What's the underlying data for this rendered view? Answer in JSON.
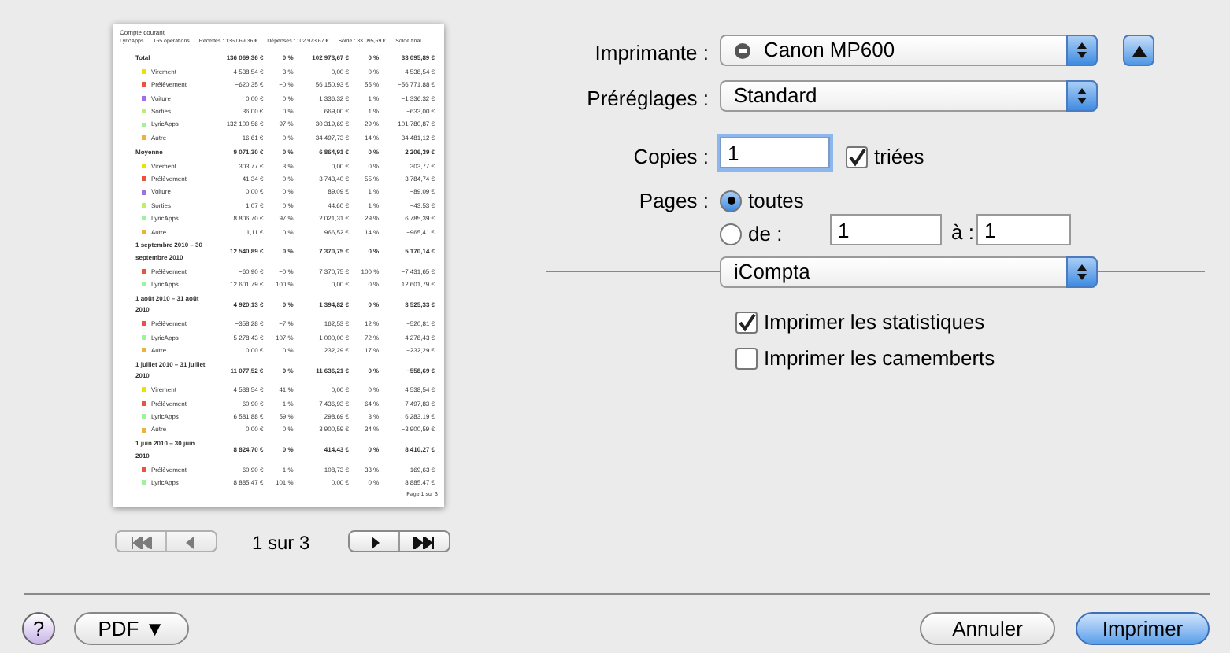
{
  "preview": {
    "document": {
      "title": "Compte courant",
      "summary": [
        "LyricApps",
        "165 opérations",
        "Recettes : 136 069,36 €",
        "Dépenses : 102 973,67 €",
        "Solde : 33 095,69 €",
        "Solde final"
      ],
      "rows": [
        {
          "kind": "group",
          "label": "Total",
          "cells": [
            "136 069,36 €",
            "0 %",
            "102 973,67 €",
            "0 %",
            "33 095,89 €"
          ]
        },
        {
          "kind": "category",
          "label": "Virement",
          "color": "#f0e000",
          "cells": [
            "4 538,54 €",
            "3 %",
            "0,00 €",
            "0 %",
            "4 538,54 €"
          ]
        },
        {
          "kind": "category",
          "label": "Prélèvement",
          "color": "#f05040",
          "cells": [
            "−620,35 €",
            "−0 %",
            "56 150,93 €",
            "55 %",
            "−56 771,88 €"
          ]
        },
        {
          "kind": "category",
          "label": "Voiture",
          "color": "#a070e0",
          "cells": [
            "0,00 €",
            "0 %",
            "1 336,32 €",
            "1 %",
            "−1 336,32 €"
          ]
        },
        {
          "kind": "category",
          "label": "Sorties",
          "color": "#c0f060",
          "cells": [
            "36,00 €",
            "0 %",
            "669,00 €",
            "1 %",
            "−633,00 €"
          ]
        },
        {
          "kind": "category",
          "label": "LyricApps",
          "color": "#a0f0a0",
          "cells": [
            "132 100,56 €",
            "97 %",
            "30 319,69 €",
            "29 %",
            "101 780,87 €"
          ]
        },
        {
          "kind": "category",
          "label": "Autre",
          "color": "#f0b040",
          "cells": [
            "16,61 €",
            "0 %",
            "34 497,73 €",
            "14 %",
            "−34 481,12 €"
          ]
        },
        {
          "kind": "group",
          "label": "Moyenne",
          "cells": [
            "9 071,30 €",
            "0 %",
            "6 864,91 €",
            "0 %",
            "2 206,39 €"
          ]
        },
        {
          "kind": "category",
          "label": "Virement",
          "color": "#f0e000",
          "cells": [
            "303,77 €",
            "3 %",
            "0,00 €",
            "0 %",
            "303,77 €"
          ]
        },
        {
          "kind": "category",
          "label": "Prélèvement",
          "color": "#f05040",
          "cells": [
            "−41,34 €",
            "−0 %",
            "3 743,40 €",
            "55 %",
            "−3 784,74 €"
          ]
        },
        {
          "kind": "category",
          "label": "Voiture",
          "color": "#a070e0",
          "cells": [
            "0,00 €",
            "0 %",
            "89,09 €",
            "1 %",
            "−89,09 €"
          ]
        },
        {
          "kind": "category",
          "label": "Sorties",
          "color": "#c0f060",
          "cells": [
            "1,07 €",
            "0 %",
            "44,60 €",
            "1 %",
            "−43,53 €"
          ]
        },
        {
          "kind": "category",
          "label": "LyricApps",
          "color": "#a0f0a0",
          "cells": [
            "8 806,70 €",
            "97 %",
            "2 021,31 €",
            "29 %",
            "6 785,39 €"
          ]
        },
        {
          "kind": "category",
          "label": "Autre",
          "color": "#f0b040",
          "cells": [
            "1,11 €",
            "0 %",
            "966,52 €",
            "14 %",
            "−965,41 €"
          ]
        },
        {
          "kind": "group",
          "label": "1 septembre 2010 – 30 septembre 2010",
          "cells": [
            "12 540,89 €",
            "0 %",
            "7 370,75 €",
            "0 %",
            "5 170,14 €"
          ]
        },
        {
          "kind": "category",
          "label": "Prélèvement",
          "color": "#f05040",
          "cells": [
            "−60,90 €",
            "−0 %",
            "7 370,75 €",
            "100 %",
            "−7 431,65 €"
          ]
        },
        {
          "kind": "category",
          "label": "LyricApps",
          "color": "#a0f0a0",
          "cells": [
            "12 601,79 €",
            "100 %",
            "0,00 €",
            "0 %",
            "12 601,79 €"
          ]
        },
        {
          "kind": "group",
          "label": "1 août 2010 – 31 août 2010",
          "cells": [
            "4 920,13 €",
            "0 %",
            "1 394,82 €",
            "0 %",
            "3 525,33 €"
          ]
        },
        {
          "kind": "category",
          "label": "Prélèvement",
          "color": "#f05040",
          "cells": [
            "−358,28 €",
            "−7 %",
            "162,53 €",
            "12 %",
            "−520,81 €"
          ]
        },
        {
          "kind": "category",
          "label": "LyricApps",
          "color": "#a0f0a0",
          "cells": [
            "5 278,43 €",
            "107 %",
            "1 000,00 €",
            "72 %",
            "4 278,43 €"
          ]
        },
        {
          "kind": "category",
          "label": "Autre",
          "color": "#f0b040",
          "cells": [
            "0,00 €",
            "0 %",
            "232,29 €",
            "17 %",
            "−232,29 €"
          ]
        },
        {
          "kind": "group",
          "label": "1 juillet 2010 – 31 juillet 2010",
          "cells": [
            "11 077,52 €",
            "0 %",
            "11 636,21 €",
            "0 %",
            "−558,69 €"
          ]
        },
        {
          "kind": "category",
          "label": "Virement",
          "color": "#f0e000",
          "cells": [
            "4 538,54 €",
            "41 %",
            "0,00 €",
            "0 %",
            "4 538,54 €"
          ]
        },
        {
          "kind": "category",
          "label": "Prélèvement",
          "color": "#f05040",
          "cells": [
            "−60,90 €",
            "−1 %",
            "7 436,93 €",
            "64 %",
            "−7 497,83 €"
          ]
        },
        {
          "kind": "category",
          "label": "LyricApps",
          "color": "#a0f0a0",
          "cells": [
            "6 581,88 €",
            "59 %",
            "298,69 €",
            "3 %",
            "6 283,19 €"
          ]
        },
        {
          "kind": "category",
          "label": "Autre",
          "color": "#f0b040",
          "cells": [
            "0,00 €",
            "0 %",
            "3 900,59 €",
            "34 %",
            "−3 900,59 €"
          ]
        },
        {
          "kind": "group",
          "label": "1 juin 2010 – 30 juin 2010",
          "cells": [
            "8 824,70 €",
            "0 %",
            "414,43 €",
            "0 %",
            "8 410,27 €"
          ]
        },
        {
          "kind": "category",
          "label": "Prélèvement",
          "color": "#f05040",
          "cells": [
            "−60,90 €",
            "−1 %",
            "108,73 €",
            "33 %",
            "−169,63 €"
          ]
        },
        {
          "kind": "category",
          "label": "LyricApps",
          "color": "#a0f0a0",
          "cells": [
            "8 885,47 €",
            "101 %",
            "0,00 €",
            "0 %",
            "8 885,47 €"
          ]
        }
      ],
      "footer": "Page 1 sur 3"
    },
    "page_indicator": "1 sur 3"
  },
  "printer": {
    "label": "Imprimante :",
    "value": "Canon MP600"
  },
  "presets": {
    "label": "Préréglages :",
    "value": "Standard"
  },
  "copies": {
    "label": "Copies :",
    "value": "1",
    "collated": {
      "label": "triées",
      "checked": true
    }
  },
  "pages": {
    "label": "Pages :",
    "options": [
      {
        "label": "toutes",
        "selected": true
      },
      {
        "label": "de :",
        "selected": false
      }
    ],
    "from": "1",
    "to_label": "à :",
    "to": "1"
  },
  "section": {
    "value": "iCompta"
  },
  "options": [
    {
      "label": "Imprimer les statistiques",
      "checked": true
    },
    {
      "label": "Imprimer les camemberts",
      "checked": false
    }
  ],
  "buttons": {
    "help": "?",
    "pdf": "PDF ▼",
    "cancel": "Annuler",
    "print": "Imprimer"
  }
}
